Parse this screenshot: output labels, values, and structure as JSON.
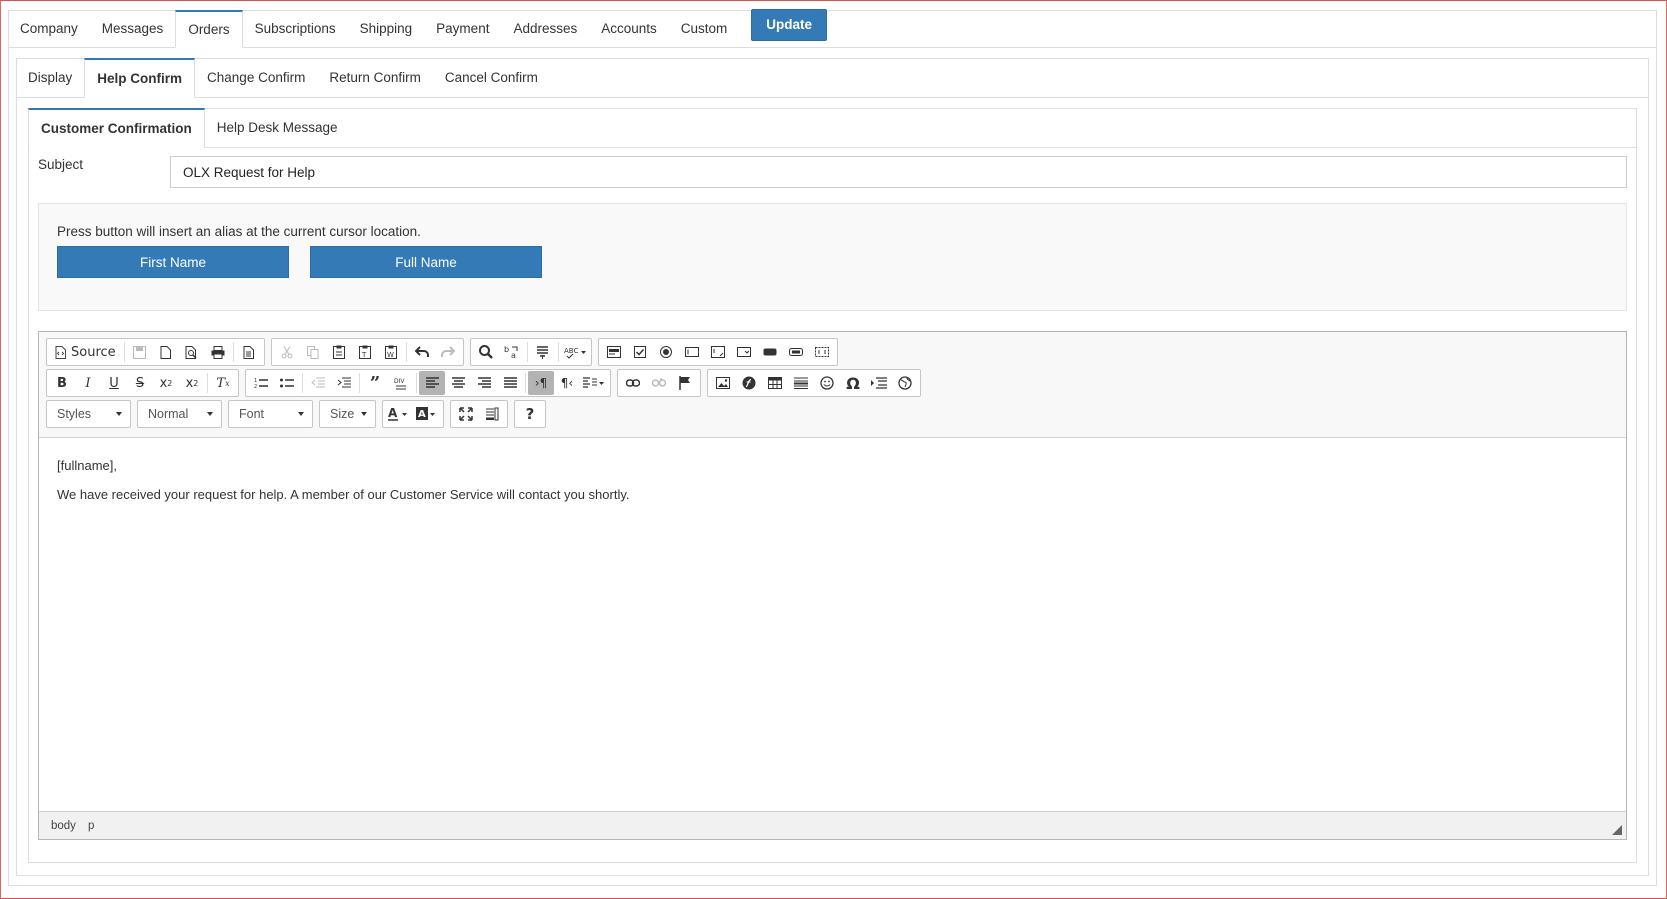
{
  "top_tabs": [
    {
      "label": "Company"
    },
    {
      "label": "Messages"
    },
    {
      "label": "Orders"
    },
    {
      "label": "Subscriptions"
    },
    {
      "label": "Shipping"
    },
    {
      "label": "Payment"
    },
    {
      "label": "Addresses"
    },
    {
      "label": "Accounts"
    },
    {
      "label": "Custom"
    }
  ],
  "active_top_tab": "Orders",
  "update_label": "Update",
  "sub_tabs": [
    {
      "label": "Display"
    },
    {
      "label": "Help Confirm"
    },
    {
      "label": "Change Confirm"
    },
    {
      "label": "Return Confirm"
    },
    {
      "label": "Cancel Confirm"
    }
  ],
  "active_sub_tab": "Help Confirm",
  "inner_tabs": [
    {
      "label": "Customer Confirmation"
    },
    {
      "label": "Help Desk Message"
    }
  ],
  "active_inner_tab": "Customer Confirmation",
  "subject": {
    "label": "Subject",
    "value": "OLX Request for Help"
  },
  "alias": {
    "hint": "Press button will insert an alias at the current cursor location.",
    "first_name_label": "First Name",
    "full_name_label": "Full Name"
  },
  "toolbar": {
    "source_label": "Source",
    "styles_label": "Styles",
    "format_label": "Normal",
    "font_label": "Font",
    "size_label": "Size"
  },
  "editor": {
    "paragraphs": [
      "[fullname],",
      "We have received your request for help. A member of our Customer Service will contact you shortly."
    ],
    "status_path": [
      "body",
      "p"
    ]
  },
  "colors": {
    "accent": "#337ab7",
    "frame_border": "#d9534f"
  }
}
